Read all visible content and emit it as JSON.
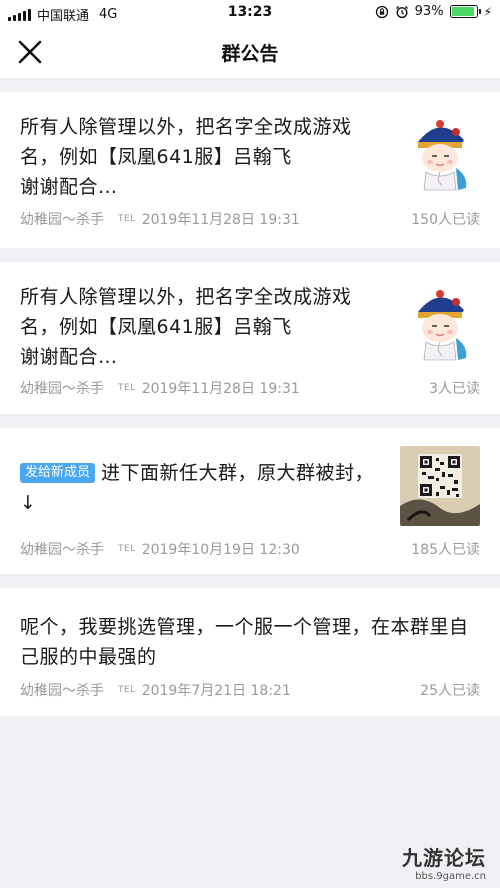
{
  "status_bar": {
    "carrier": "中国联通",
    "network": "4G",
    "time": "13:23",
    "battery_percent": "93%",
    "battery_level": 0.93
  },
  "nav": {
    "title": "群公告",
    "close_icon": "close-icon"
  },
  "announcements": [
    {
      "text_line1": "所有人除管理以外，把名字全改成游戏",
      "text_line2": "名，例如【凤凰641服】吕翰飞",
      "text_line3": "谢谢配合…",
      "author": "幼稚园～杀手",
      "tel_label": "TEL",
      "date": "2019年11月28日 19:31",
      "reads": "150人已读",
      "thumb": "cartoon-character"
    },
    {
      "text_line1": "所有人除管理以外，把名字全改成游戏",
      "text_line2": "名，例如【凤凰641服】吕翰飞",
      "text_line3": "谢谢配合…",
      "author": "幼稚园～杀手",
      "tel_label": "TEL",
      "date": "2019年11月28日 19:31",
      "reads": "3人已读",
      "thumb": "cartoon-character"
    },
    {
      "badge": "发给新成员",
      "text_line1": "进下面新任大群，原大群被封，",
      "text_line2": "↓",
      "author": "幼稚园～杀手",
      "tel_label": "TEL",
      "date": "2019年10月19日 12:30",
      "reads": "185人已读",
      "thumb": "qr-code"
    },
    {
      "text_line1": "呢个，我要挑选管理，一个服一个管理，在本群里自",
      "text_line2": "己服的中最强的",
      "author": "幼稚园～杀手",
      "tel_label": "TEL",
      "date": "2019年7月21日 18:21",
      "reads": "25人已读"
    }
  ],
  "watermark": {
    "title": "九游论坛",
    "url": "bbs.9game.cn"
  }
}
